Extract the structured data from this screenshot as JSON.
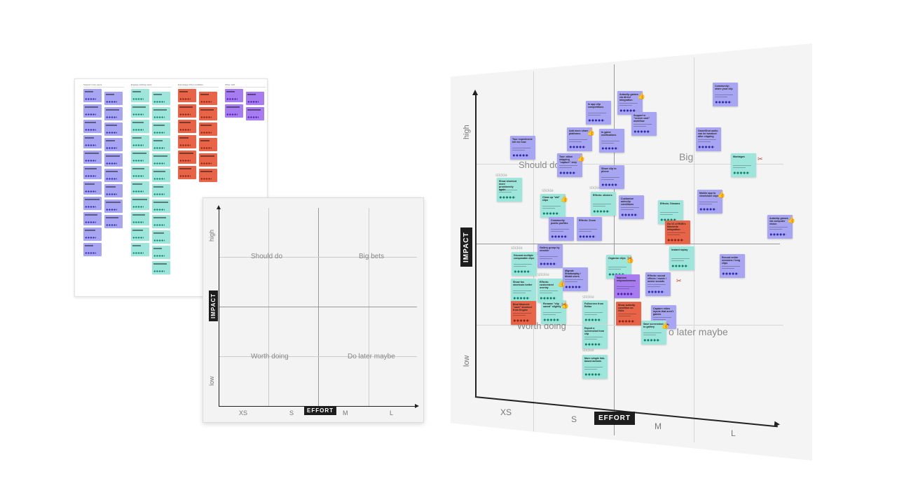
{
  "backlog_board": {
    "columns": [
      {
        "header": "Support more users",
        "color": "blue",
        "count_a": 11,
        "count_b": 9
      },
      {
        "header": "Engage existing users",
        "color": "teal",
        "count_a": 11,
        "count_b": 12
      },
      {
        "header": "Encourage richer portfolios",
        "color": "red",
        "count_a": 6,
        "count_b": 6
      },
      {
        "header": "Other stuff",
        "color": "purple",
        "count_a": 2,
        "count_b": 2
      }
    ]
  },
  "empty_matrix": {
    "quadrants": {
      "top_left": "Should do",
      "top_right": "Big bets",
      "bottom_left": "Worth doing",
      "bottom_right": "Do later maybe"
    },
    "y_axis_label": "IMPACT",
    "x_axis_label": "EFFORT",
    "y_ticks": {
      "high": "high",
      "low": "low"
    },
    "x_ticks": [
      "XS",
      "S",
      "M",
      "L"
    ]
  },
  "filled_matrix": {
    "quadrants": {
      "top_left": "Should do",
      "top_right": "Big",
      "bottom_left": "Worth doing",
      "bottom_right": "o later maybe"
    },
    "y_axis_label": "IMPACT",
    "x_axis_label": "EFFORT",
    "y_ticks": {
      "high": "high",
      "low": "low"
    },
    "x_ticks": [
      "XS",
      "S",
      "M",
      "L"
    ],
    "section_tag": "stickie",
    "notes": [
      {
        "title": "Autoclip games via direct integration",
        "color": "blue"
      },
      {
        "title": "Community: share your clip",
        "color": "blue"
      },
      {
        "title": "In app clip competitions",
        "color": "blue"
      },
      {
        "title": "Support a \"screen cast\" workflow",
        "color": "blue"
      },
      {
        "title": "Add more share platforms",
        "color": "blue"
      },
      {
        "title": "In game notifications",
        "color": "blue"
      },
      {
        "title": "GameShot audio can be tweaked after clipping",
        "color": "blue"
      },
      {
        "title": "Tour experiment: tell me how",
        "color": "blue"
      },
      {
        "title": "Tour: allow skipping \"capture\" step",
        "color": "blue"
      },
      {
        "title": "Montages",
        "color": "teal"
      },
      {
        "title": "Share clip to phone",
        "color": "blue"
      },
      {
        "title": "Show shortcut more prominently again",
        "color": "teal"
      },
      {
        "title": "Clean up \"old\" clips",
        "color": "teal"
      },
      {
        "title": "Effects: stickers",
        "color": "teal"
      },
      {
        "title": "Customize autoclip conditions",
        "color": "blue"
      },
      {
        "title": "Effects: Streams",
        "color": "teal"
      },
      {
        "title": "Mobile app to view/share clips",
        "color": "blue"
      },
      {
        "title": "Community public profiles",
        "color": "blue"
      },
      {
        "title": "Effects: Zoom",
        "color": "blue"
      },
      {
        "title": "Go V1 of RGB's Moments integration",
        "color": "red"
      },
      {
        "title": "Autoclip games via computer vision",
        "color": "blue"
      },
      {
        "title": "Gallery group by session",
        "color": "blue"
      },
      {
        "title": "Discard multiple comparable clips",
        "color": "teal"
      },
      {
        "title": "Migrate Shadowplay / Medal users",
        "color": "blue"
      },
      {
        "title": "Organize clips",
        "color": "teal"
      },
      {
        "title": "Instant replay",
        "color": "teal"
      },
      {
        "title": "Record entire sessions / long clips",
        "color": "blue"
      },
      {
        "title": "Show tos shortcuts better",
        "color": "teal"
      },
      {
        "title": "Effects: customized overlay",
        "color": "teal"
      },
      {
        "title": "Improve responsiveness",
        "color": "purple"
      },
      {
        "title": "Effects: sound effects / music / meme sounds",
        "color": "blue"
      },
      {
        "title": "Bind Moment: \"save\" shortcut from Engine",
        "color": "red"
      },
      {
        "title": "Rename \"clip saved\" slightly",
        "color": "teal"
      },
      {
        "title": "Fullscreen from Editor",
        "color": "teal"
      },
      {
        "title": "Show autoclip condition on GUIs",
        "color": "red"
      },
      {
        "title": "Capture video inputs that aren't games",
        "color": "blue"
      },
      {
        "title": "Save screenshot to gallery",
        "color": "teal"
      },
      {
        "title": "Export a screenshot from clip",
        "color": "teal"
      },
      {
        "title": "More simple link-based actions",
        "color": "teal"
      }
    ]
  }
}
